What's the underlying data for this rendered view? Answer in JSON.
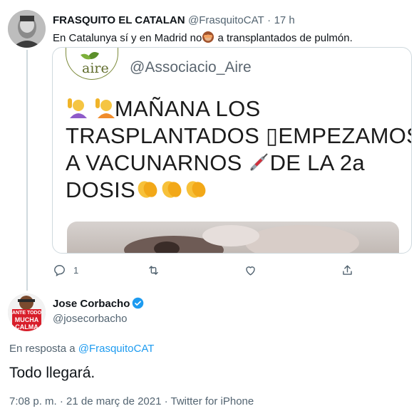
{
  "tweet1": {
    "display_name": "FRASQUITO EL CATALAN",
    "handle": "@FrasquitoCAT",
    "separator": "·",
    "time": "17 h",
    "text_before": "En Catalunya sí y en Madrid no",
    "text_after": " a transplantados de pulmón.",
    "quoted": {
      "logo_text": "aire",
      "account": "@Associacio_Aire",
      "line1": "MAÑANA LOS",
      "line2": "TRASPLANTADOS ▯EMPEZAMOS",
      "line3": "A VACUNARNOS",
      "line3b": "DE LA 2a",
      "line4": "DOSIS"
    },
    "actions": {
      "reply_count": "1"
    }
  },
  "tweet2": {
    "display_name": "Jose Corbacho",
    "handle": "@josecorbacho",
    "avatar_text": [
      "ANTE TODO",
      "MUCHA",
      "CALMA"
    ],
    "reply_prefix": "En resposta a",
    "reply_to": "@FrasquitoCAT",
    "text": "Todo llegará.",
    "meta": "7:08 p. m. · 21 de març de 2021 · Twitter for iPhone"
  },
  "colors": {
    "accent": "#1d9bf0",
    "muted": "#536471",
    "border": "#cfd9de"
  }
}
